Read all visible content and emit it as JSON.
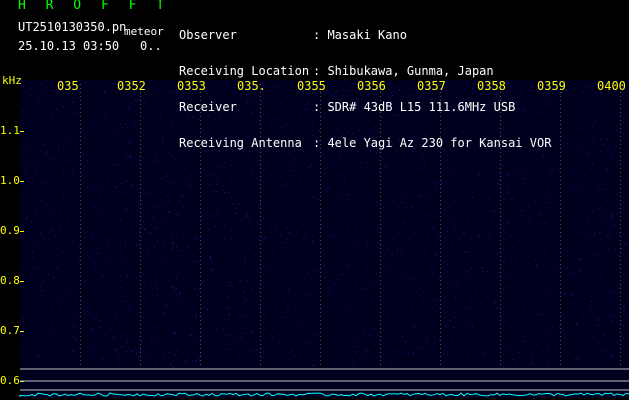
{
  "header": {
    "title": "H R O F F T",
    "file_name": "UT2510130350.pn",
    "event_label": "meteor",
    "date_time": "25.10.13 03:50",
    "count_value": "0.."
  },
  "metadata": [
    {
      "label": "Observer",
      "value": ": Masaki Kano"
    },
    {
      "label": "Receiving Location",
      "value": ": Shibukawa, Gunma, Japan"
    },
    {
      "label": "Receiver",
      "value": ": SDR# 43dB L15 111.6MHz USB"
    },
    {
      "label": "Receiving Antenna",
      "value": ": 4ele Yagi Az 230 for Kansai VOR"
    }
  ],
  "time_axis": {
    "ticks": [
      "035",
      "0352",
      "0353",
      "035.",
      "0355",
      "0356",
      "0357",
      "0358",
      "0359",
      "0400"
    ]
  },
  "freq_axis": {
    "unit_label": "kHz",
    "ticks": [
      "1.1",
      "1.0",
      "0.9",
      "0.8",
      "0.7",
      "0.6"
    ]
  },
  "colors": {
    "background": "#000000",
    "spectrogram_base": "#00001e",
    "noise": "#2828c8",
    "trace": "#00ffff",
    "text_green": "#00ff00",
    "text_yellow": "#ffff00",
    "text_white": "#ffffff"
  }
}
